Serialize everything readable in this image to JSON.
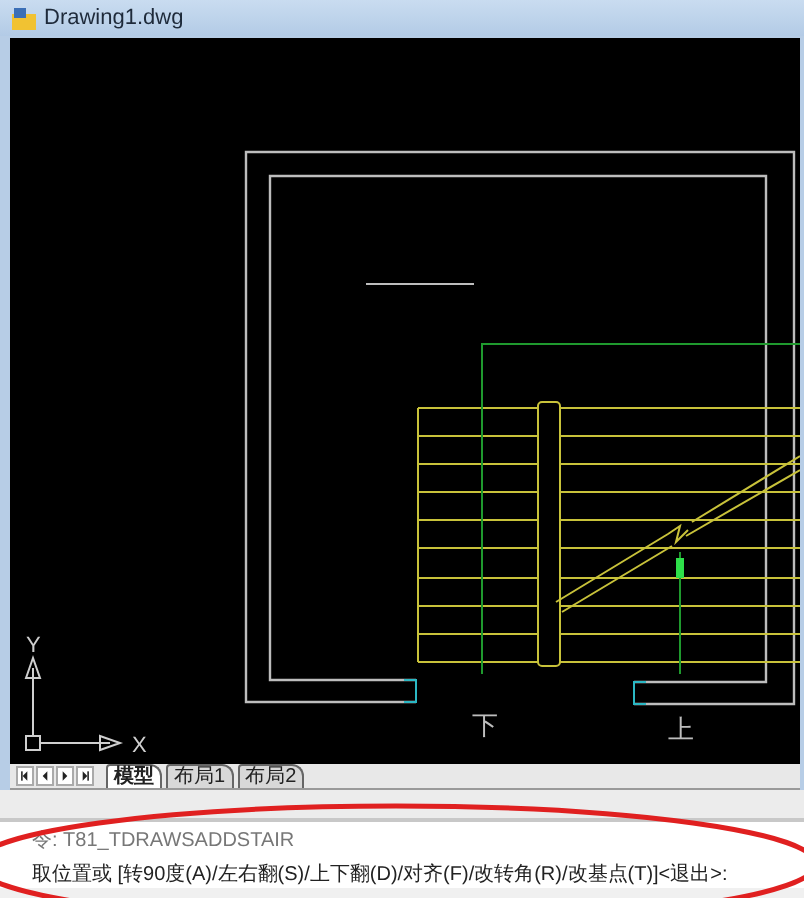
{
  "window": {
    "title": "Drawing1.dwg"
  },
  "drawing": {
    "labels": [
      {
        "text": "下"
      },
      {
        "text": "上"
      }
    ],
    "ucs": {
      "x_label": "X",
      "y_label": "Y"
    }
  },
  "layout_tabs": [
    {
      "label": "模型",
      "selected": true
    },
    {
      "label": "布局1",
      "selected": false
    },
    {
      "label": "布局2",
      "selected": false
    }
  ],
  "command_line": {
    "history": "令:  T81_TDRAWSADDSTAIR",
    "prompt": "取位置或 [转90度(A)/左右翻(S)/上下翻(D)/对齐(F)/改转角(R)/改基点(T)]<退出>:"
  }
}
